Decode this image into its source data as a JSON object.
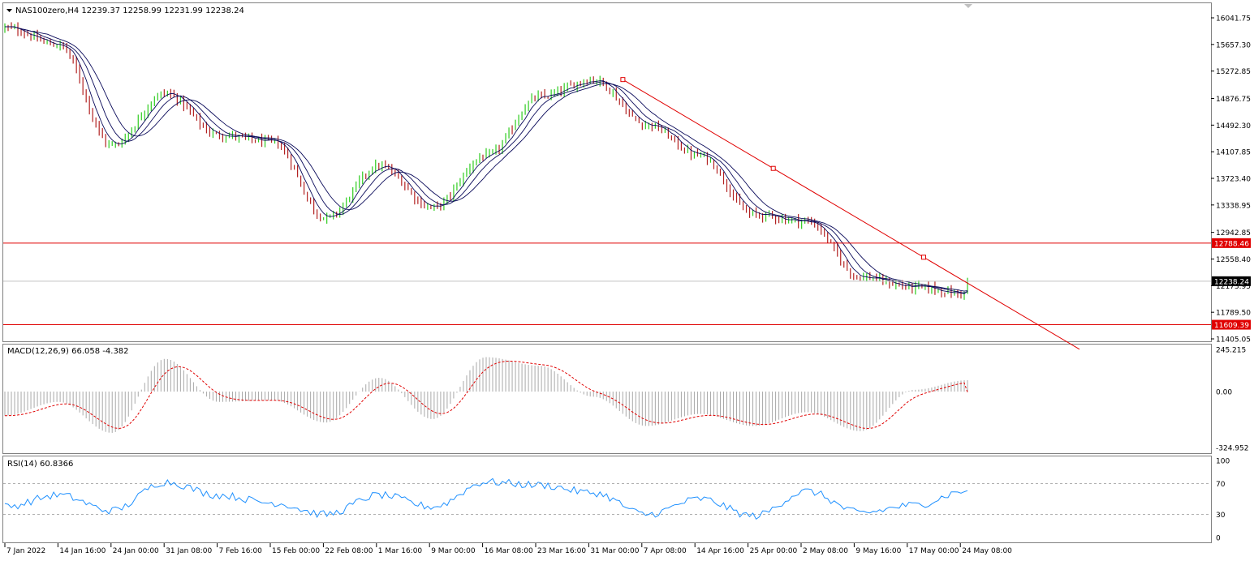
{
  "main_header": "NAS100zero,H4  12239.37 12258.99 12231.99 12238.24",
  "price_axis_ticks": [
    "16041.75",
    "15657.30",
    "15272.85",
    "14876.75",
    "14492.30",
    "14107.85",
    "13723.40",
    "13338.95",
    "12942.85",
    "12558.40",
    "12173.95",
    "11789.50",
    "11405.05"
  ],
  "macd_header": "MACD(12,26,9) 66.058 -4.382",
  "macd_axis_ticks": [
    "245.215",
    "0.00",
    "-324.952"
  ],
  "rsi_header": "RSI(14) 60.8366",
  "rsi_axis_ticks": [
    "100",
    "70",
    "30",
    "0"
  ],
  "time_axis_ticks": [
    "7 Jan 2022",
    "14 Jan 16:00",
    "24 Jan 00:00",
    "31 Jan 08:00",
    "7 Feb 16:00",
    "15 Feb 00:00",
    "22 Feb 08:00",
    "1 Mar 16:00",
    "9 Mar 00:00",
    "16 Mar 08:00",
    "23 Mar 16:00",
    "31 Mar 00:00",
    "7 Apr 08:00",
    "14 Apr 16:00",
    "25 Apr 00:00",
    "2 May 08:00",
    "9 May 16:00",
    "17 May 00:00",
    "24 May 08:00"
  ],
  "resistance_label": "12788.46",
  "current_price_label": "12238.24",
  "support_label": "11609.39",
  "colors": {
    "bull": "#2ecc1f",
    "bear": "#b22222",
    "ma": "#0a0a5a",
    "level_line": "#e00000",
    "trendline": "#e00000",
    "macd_hist": "#a8a8a8",
    "macd_signal": "#e00000",
    "rsi": "#1e90ff",
    "price_tag_bg": "#000000",
    "level_tag_bg": "#e00000"
  },
  "chart_data": [
    {
      "type": "candlestick",
      "symbol": "NAS100zero",
      "timeframe": "H4",
      "ohlc_last": {
        "open": 12239.37,
        "high": 12258.99,
        "low": 12231.99,
        "close": 12238.24
      },
      "ylim": [
        11405.05,
        16041.75
      ],
      "x": [
        "7 Jan 2022",
        "14 Jan 16:00",
        "24 Jan 00:00",
        "31 Jan 08:00",
        "7 Feb 16:00",
        "15 Feb 00:00",
        "22 Feb 08:00",
        "1 Mar 16:00",
        "9 Mar 00:00",
        "16 Mar 08:00",
        "23 Mar 16:00",
        "31 Mar 00:00",
        "7 Apr 08:00",
        "14 Apr 16:00",
        "25 Apr 00:00",
        "2 May 08:00",
        "9 May 16:00",
        "17 May 00:00",
        "24 May 08:00"
      ],
      "close_path_by_tick": [
        15900,
        15650,
        14200,
        14950,
        14350,
        14250,
        13150,
        13900,
        13300,
        14050,
        14900,
        15150,
        14500,
        14050,
        13200,
        13100,
        12300,
        12150,
        12050
      ],
      "series_end_close": 12238.24,
      "horizontal_levels": [
        12788.46,
        11609.39
      ],
      "current_price": 12238.24,
      "trendline_from": {
        "x": "31 Mar 00:00",
        "price": 15150
      },
      "moving_averages": 3,
      "grid": false
    },
    {
      "type": "histogram+line",
      "indicator": "MACD",
      "params": "12,26,9",
      "last_values": [
        66.058,
        -4.382
      ],
      "ylim": [
        -324.952,
        245.215
      ],
      "hist_path_by_tick": [
        -140,
        -60,
        -240,
        190,
        -60,
        -50,
        -180,
        80,
        -160,
        200,
        150,
        -30,
        -200,
        -130,
        -200,
        -120,
        -230,
        10,
        66
      ]
    },
    {
      "type": "line",
      "indicator": "RSI",
      "period": 14,
      "last_value": 60.8366,
      "ylim": [
        0,
        100
      ],
      "levels": [
        70,
        30
      ],
      "path_by_tick": [
        40,
        55,
        35,
        72,
        55,
        45,
        30,
        55,
        40,
        72,
        68,
        58,
        30,
        50,
        28,
        60,
        32,
        42,
        60.8
      ]
    }
  ]
}
